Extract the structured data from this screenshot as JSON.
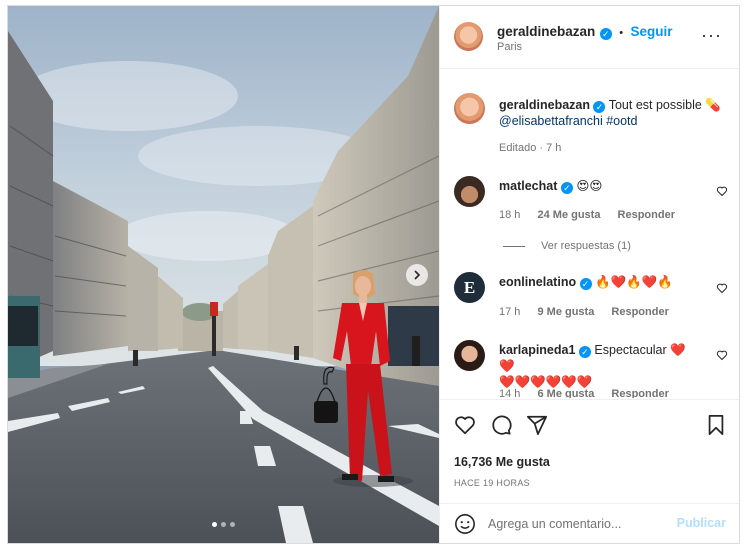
{
  "post": {
    "author": "geraldinebazan",
    "location": "Paris",
    "follow_label": "Seguir",
    "separator": "•",
    "more_icon": "more-horizontal-icon",
    "caption": {
      "author": "geraldinebazan",
      "text": "Tout est possible",
      "emoji": "💊",
      "mention": "@elisabettafranchi",
      "hashtag": "#ootd",
      "edited": "Editado · 7 h"
    },
    "carousel": {
      "slides": 3,
      "active": 1
    }
  },
  "comments": [
    {
      "user": "matlechat",
      "text": "😍😍",
      "time": "18 h",
      "likes": "24 Me gusta",
      "reply": "Responder",
      "view_replies": "Ver respuestas (1)"
    },
    {
      "user": "eonlinelatino",
      "text": "🔥❤️🔥❤️🔥",
      "time": "17 h",
      "likes": "9 Me gusta",
      "reply": "Responder"
    },
    {
      "user": "karlapineda1",
      "text": "Espectacular ❤️❤️",
      "text2": "❤️❤️❤️❤️❤️❤️",
      "time": "14 h",
      "likes": "6 Me gusta",
      "reply": "Responder"
    }
  ],
  "stats": {
    "likes": "16,736 Me gusta",
    "ago": "HACE 19 HORAS"
  },
  "composer": {
    "placeholder": "Agrega un comentario...",
    "publish": "Publicar"
  },
  "colors": {
    "accent": "#0095f6",
    "muted": "#737373",
    "publish_disabled": "#b2dffc",
    "outfit_red": "#d8141c"
  }
}
